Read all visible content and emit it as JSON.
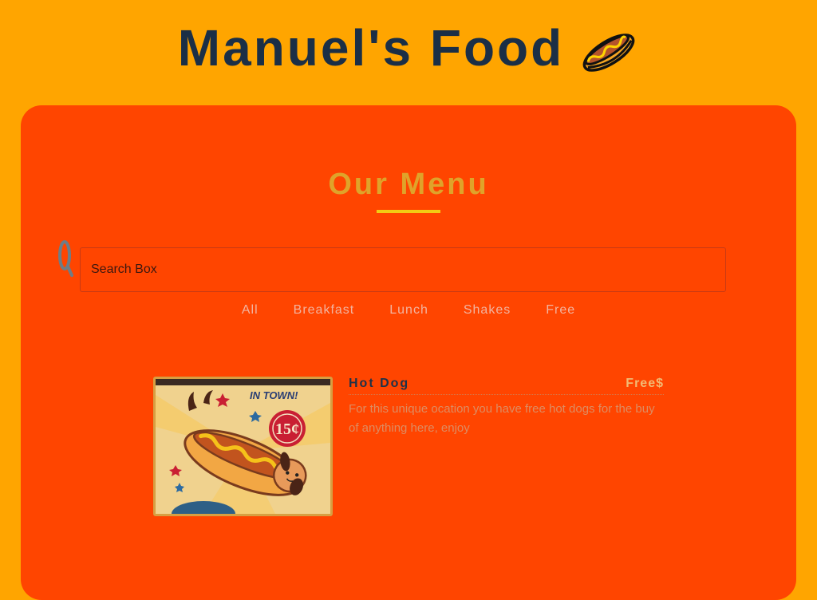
{
  "header": {
    "title": "Manuel's Food",
    "icon": "hotdog-icon"
  },
  "menu": {
    "heading": "Our Menu",
    "search": {
      "placeholder": "Search Box",
      "value": ""
    },
    "filters": [
      "All",
      "Breakfast",
      "Lunch",
      "Shakes",
      "Free"
    ],
    "items": [
      {
        "name": "Hot Dog",
        "price": "Free$",
        "description": "For this unique ocation you have free hot dogs for the buy of anything here, enjoy",
        "image": {
          "headline": "IN TOWN!",
          "price_badge": "15¢"
        }
      }
    ]
  },
  "colors": {
    "page_background": "#ffa500",
    "panel_background": "#ff4500",
    "title_color": "#1b2f46",
    "heading_color": "#dfa32a",
    "underline_color": "#f2cc14"
  }
}
